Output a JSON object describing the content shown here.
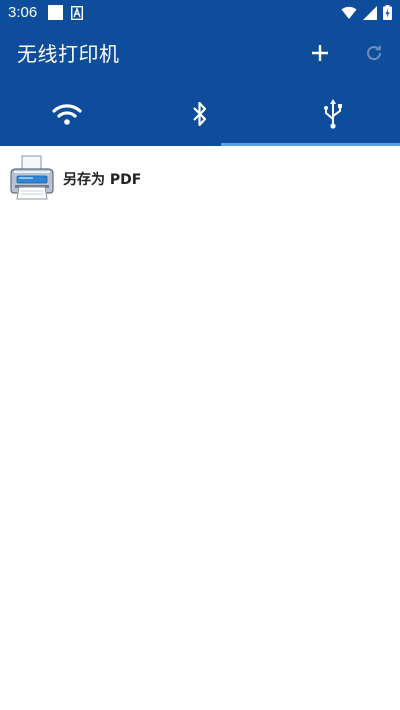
{
  "status_bar": {
    "time": "3:06",
    "icons": [
      "square-notification-icon",
      "a-notification-icon",
      "wifi-signal-icon",
      "cell-signal-icon",
      "battery-charging-icon"
    ]
  },
  "app_bar": {
    "title": "无线打印机",
    "actions": [
      "add-icon",
      "refresh-icon"
    ]
  },
  "tabs": [
    {
      "icon": "wifi-icon",
      "selected": false
    },
    {
      "icon": "bluetooth-icon",
      "selected": false
    },
    {
      "icon": "usb-icon",
      "selected": true
    }
  ],
  "printers": [
    {
      "label": "另存为 PDF",
      "icon": "printer-icon"
    }
  ],
  "colors": {
    "primary": "#0d4d9b",
    "tab_indicator": "#5aa0e8",
    "background": "#ffffff",
    "text": "#222222"
  }
}
